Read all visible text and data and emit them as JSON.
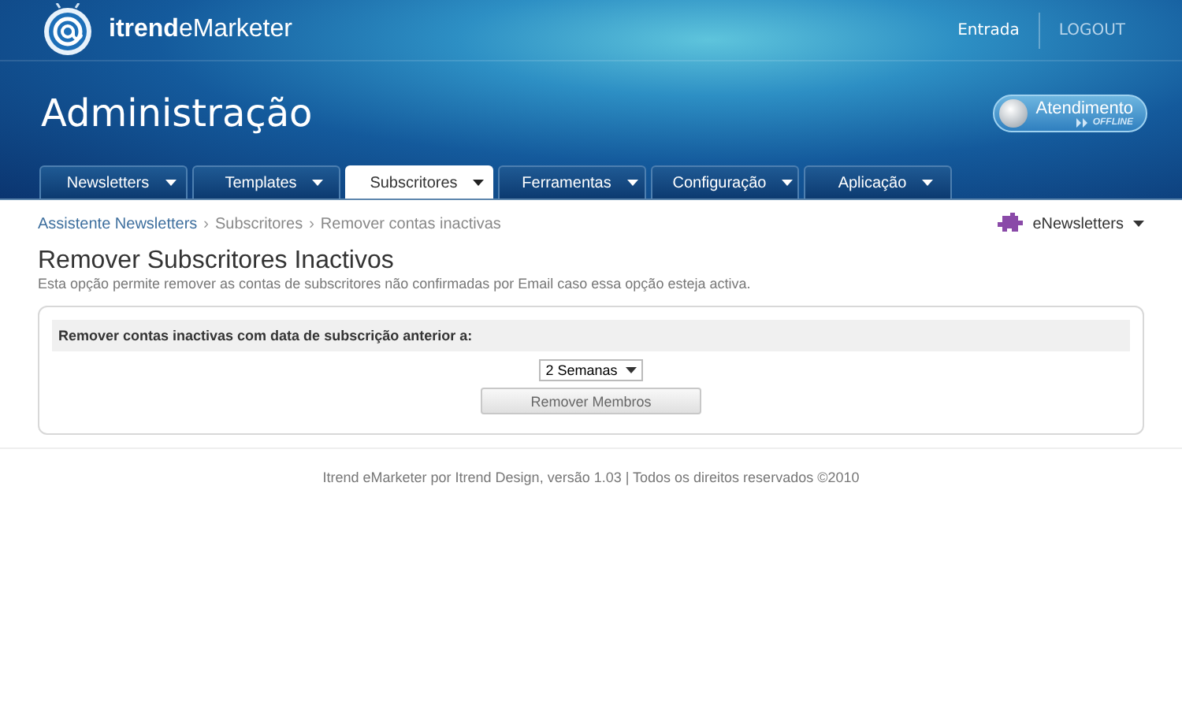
{
  "header": {
    "logo_text": "**itrend**eMarketer",
    "links": [
      {
        "label": "Entrada",
        "selected": true
      },
      {
        "label": "LOGOUT",
        "selected": false
      }
    ],
    "title": "Administração",
    "support": {
      "label": "Atendimento",
      "status": "OFFLINE",
      "online": false
    }
  },
  "tabs": [
    {
      "label": "Newsletters",
      "selected": false
    },
    {
      "label": "Templates",
      "selected": false
    },
    {
      "label": "Subscritores",
      "selected": true
    },
    {
      "label": "Ferramentas",
      "selected": false
    },
    {
      "label": "Configuração",
      "selected": false
    },
    {
      "label": "Aplicação",
      "selected": false
    }
  ],
  "breadcrumb": {
    "separator": "›",
    "items": [
      {
        "label": "Assistente Newsletters",
        "kind": "link"
      },
      {
        "label": "Subscritores",
        "kind": "text"
      },
      {
        "label": "Remover contas inactivas",
        "kind": "text"
      }
    ]
  },
  "module_menu": {
    "label": "eNewsletters"
  },
  "page": {
    "title": "Remover Subscritores Inactivos",
    "description": "Esta opção permite remover as contas de subscritores não confirmadas por Email caso essa opção esteja activa."
  },
  "form": {
    "label": "Remover contas inactivas com data de subscrição anterior a:",
    "period": "2 Semanas",
    "button": "Remover Membros"
  },
  "footer": "Itrend eMarketer por Itrend Design, versão 1.03 | Todos os direitos reservados ©2010"
}
